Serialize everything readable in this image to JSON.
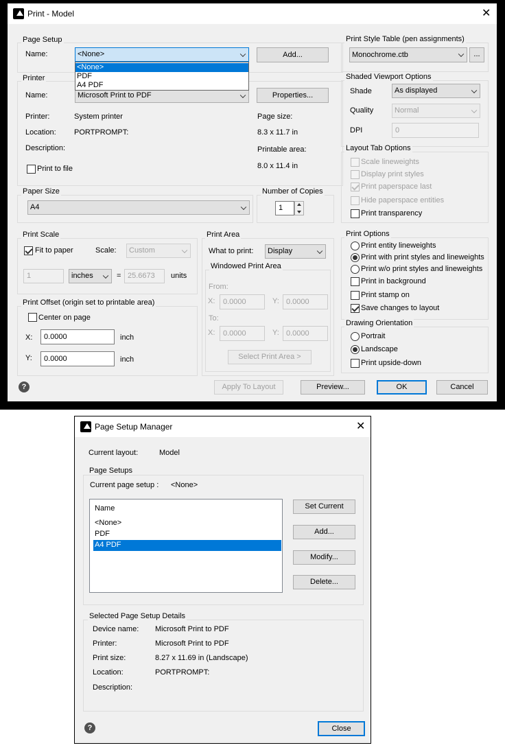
{
  "print_dialog": {
    "title": "Print - Model",
    "page_setup": {
      "legend": "Page Setup",
      "name_label": "Name:",
      "name_value": "<None>",
      "add_button": "Add...",
      "options": [
        "<None>",
        "PDF",
        "A4 PDF"
      ]
    },
    "printer": {
      "legend": "Printer",
      "name_label": "Name:",
      "name_value": "Microsoft Print to PDF",
      "properties_button": "Properties...",
      "printer_label": "Printer:",
      "printer_value": "System printer",
      "location_label": "Location:",
      "location_value": "PORTPROMPT:",
      "description_label": "Description:",
      "page_size_label": "Page size:",
      "page_size_value": "8.3 x 11.7 in",
      "printable_area_label": "Printable area:",
      "printable_area_value": "8.0 x 11.4 in",
      "print_to_file_label": "Print to file"
    },
    "paper_size": {
      "legend": "Paper Size",
      "value": "A4"
    },
    "copies": {
      "legend": "Number of Copies",
      "value": "1"
    },
    "print_scale": {
      "legend": "Print Scale",
      "fit_label": "Fit to paper",
      "scale_label": "Scale:",
      "scale_value": "Custom",
      "value1": "1",
      "unit": "inches",
      "equals": "=",
      "value2": "25.6673",
      "units_label": "units"
    },
    "print_offset": {
      "legend": "Print Offset (origin set to printable area)",
      "center_label": "Center on page",
      "x_label": "X:",
      "x_value": "0.0000",
      "y_label": "Y:",
      "y_value": "0.0000",
      "x_unit": "inch",
      "y_unit": "inch"
    },
    "print_area": {
      "legend": "Print Area",
      "what_label": "What to print:",
      "what_value": "Display",
      "windowed_legend": "Windowed Print Area",
      "from_label": "From:",
      "to_label": "To:",
      "x_label": "X:",
      "y_label": "Y:",
      "from_x": "0.0000",
      "from_y": "0.0000",
      "to_x": "0.0000",
      "to_y": "0.0000",
      "select_button": "Select Print Area >"
    },
    "style_table": {
      "legend": "Print Style Table (pen assignments)",
      "value": "Monochrome.ctb",
      "browse": "..."
    },
    "shaded": {
      "legend": "Shaded Viewport Options",
      "shade_label": "Shade",
      "shade_value": "As displayed",
      "quality_label": "Quality",
      "quality_value": "Normal",
      "dpi_label": "DPI",
      "dpi_value": "0"
    },
    "layout_tab": {
      "legend": "Layout Tab Options",
      "scale_lw": "Scale lineweights",
      "display_styles": "Display print styles",
      "paperspace_last": "Print paperspace last",
      "hide_paperspace": "Hide paperspace entities",
      "transparency": "Print transparency"
    },
    "print_options": {
      "legend": "Print Options",
      "entity_lw": "Print entity lineweights",
      "with_styles": "Print with print styles and lineweights",
      "wo_styles": "Print w/o print styles and lineweights",
      "background": "Print in background",
      "stamp": "Print stamp on",
      "save_changes": "Save changes to layout"
    },
    "orientation": {
      "legend": "Drawing Orientation",
      "portrait": "Portrait",
      "landscape": "Landscape",
      "upside_down": "Print upside-down"
    },
    "buttons": {
      "apply": "Apply To Layout",
      "preview": "Preview...",
      "ok": "OK",
      "cancel": "Cancel"
    }
  },
  "page_setup_manager": {
    "title": "Page Setup Manager",
    "current_layout_label": "Current layout:",
    "current_layout_value": "Model",
    "setups_legend": "Page Setups",
    "current_setup_label": "Current page setup :",
    "current_setup_value": "<None>",
    "list_header": "Name",
    "list_items": [
      "<None>",
      "PDF",
      "A4 PDF"
    ],
    "buttons": {
      "set_current": "Set Current",
      "add": "Add...",
      "modify": "Modify...",
      "delete": "Delete...",
      "close": "Close"
    },
    "details": {
      "legend": "Selected Page Setup Details",
      "device_label": "Device name:",
      "device_value": "Microsoft Print to PDF",
      "printer_label": "Printer:",
      "printer_value": "Microsoft Print to PDF",
      "size_label": "Print size:",
      "size_value": "8.27 x 11.69 in (Landscape)",
      "location_label": "Location:",
      "location_value": "PORTPROMPT:",
      "description_label": "Description:"
    }
  }
}
